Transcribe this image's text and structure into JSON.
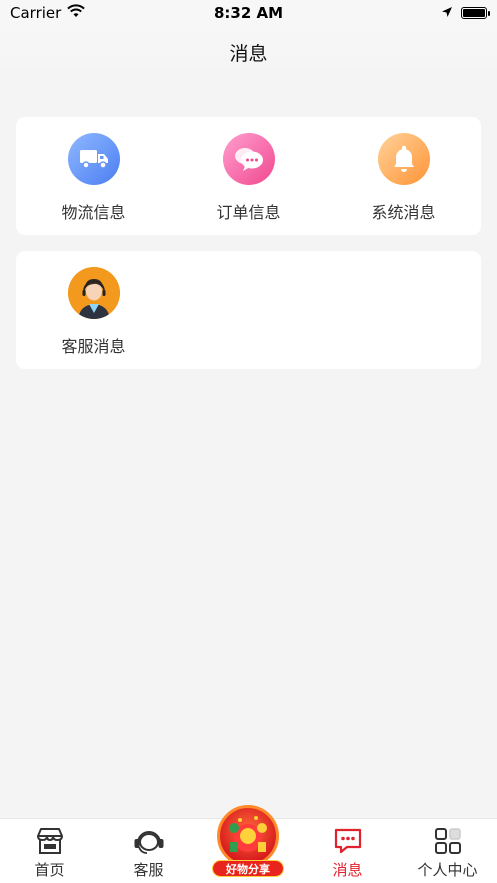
{
  "status_bar": {
    "carrier": "Carrier",
    "time": "8:32 AM"
  },
  "navbar": {
    "title": "消息"
  },
  "message_categories": [
    {
      "label": "物流信息",
      "icon": "truck-icon",
      "color": "#4b7ef2"
    },
    {
      "label": "订单信息",
      "icon": "chat-bubbles-icon",
      "color": "#f0488f"
    },
    {
      "label": "系统消息",
      "icon": "bell-icon",
      "color": "#ff9436"
    }
  ],
  "service_categories": [
    {
      "label": "客服消息",
      "icon": "customer-service-avatar-icon",
      "color": "#f39a1e"
    }
  ],
  "tab_bar": {
    "active_color": "#e0212e",
    "items": [
      {
        "label": "首页",
        "icon": "shop-icon"
      },
      {
        "label": "客服",
        "icon": "headset-icon"
      },
      {
        "label": "好物分享",
        "icon": "gift-share-icon"
      },
      {
        "label": "消息",
        "icon": "message-icon",
        "active": true
      },
      {
        "label": "个人中心",
        "icon": "grid-icon"
      }
    ]
  }
}
